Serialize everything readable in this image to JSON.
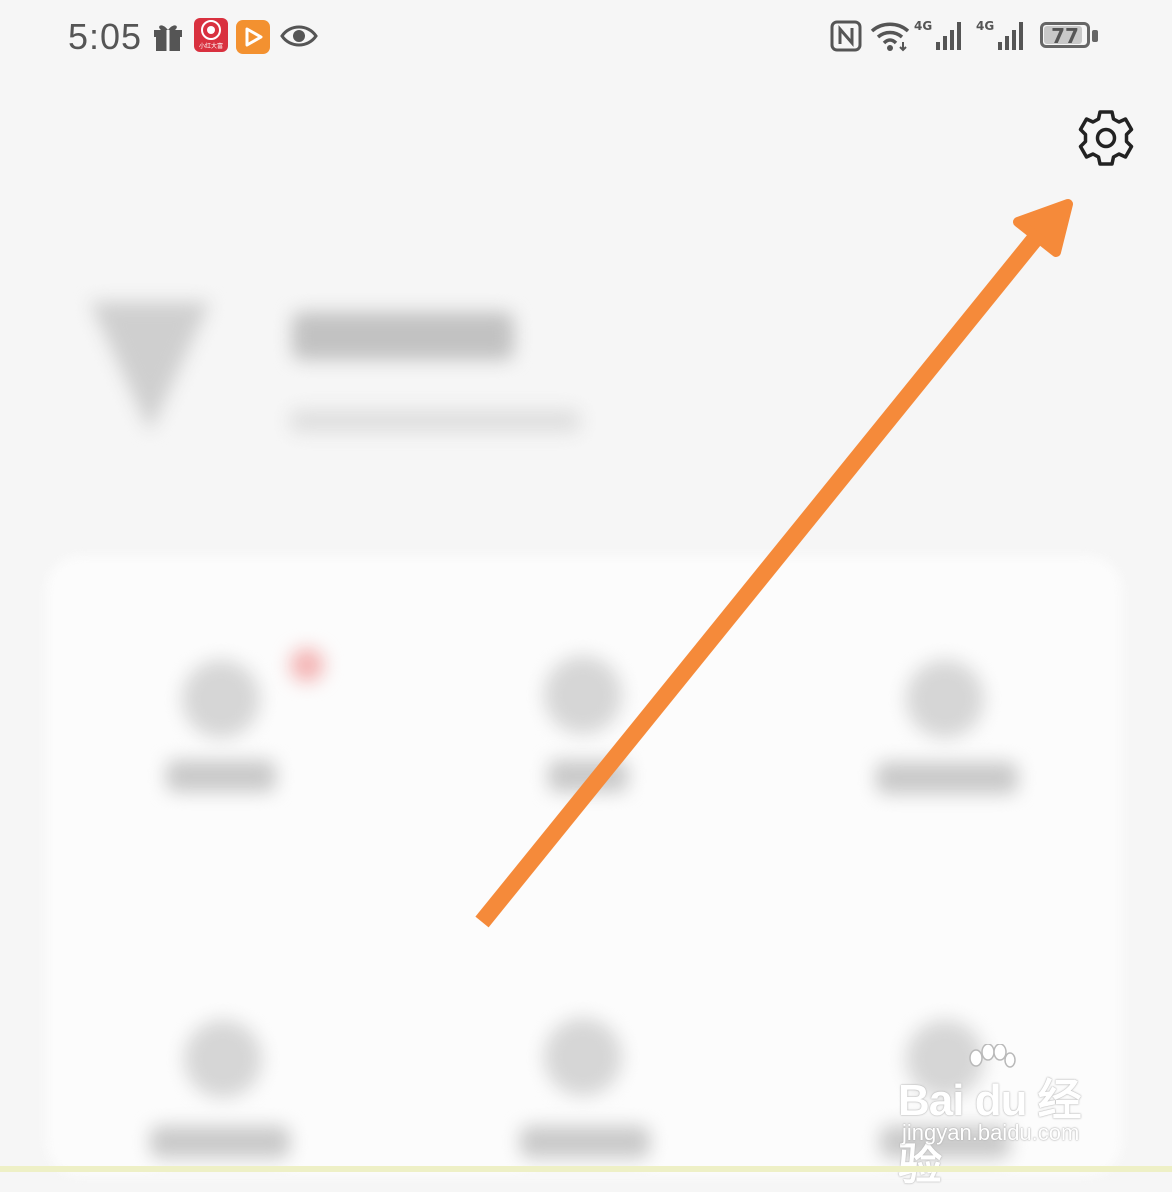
{
  "status_bar": {
    "time": "5:05",
    "left_icons": [
      "gift-icon",
      "red-app-icon",
      "orange-play-app-icon",
      "eye-icon"
    ],
    "red_app_text": "小红大富",
    "right_icons": [
      "nfc-icon",
      "wifi-icon",
      "signal-4g-icon",
      "signal-4g-icon",
      "battery-icon"
    ],
    "network_type_1": "4G",
    "network_type_2": "4G",
    "battery_level": "77"
  },
  "header": {
    "settings_icon": "gear-icon"
  },
  "annotation": {
    "arrow_color": "#f58a3a",
    "points_to": "settings"
  },
  "watermark": {
    "brand": "Bai du 经验",
    "url": "jingyan.baidu.com"
  },
  "colors": {
    "background": "#f6f6f6",
    "card": "#fcfcfc",
    "arrow": "#f58a3a"
  }
}
